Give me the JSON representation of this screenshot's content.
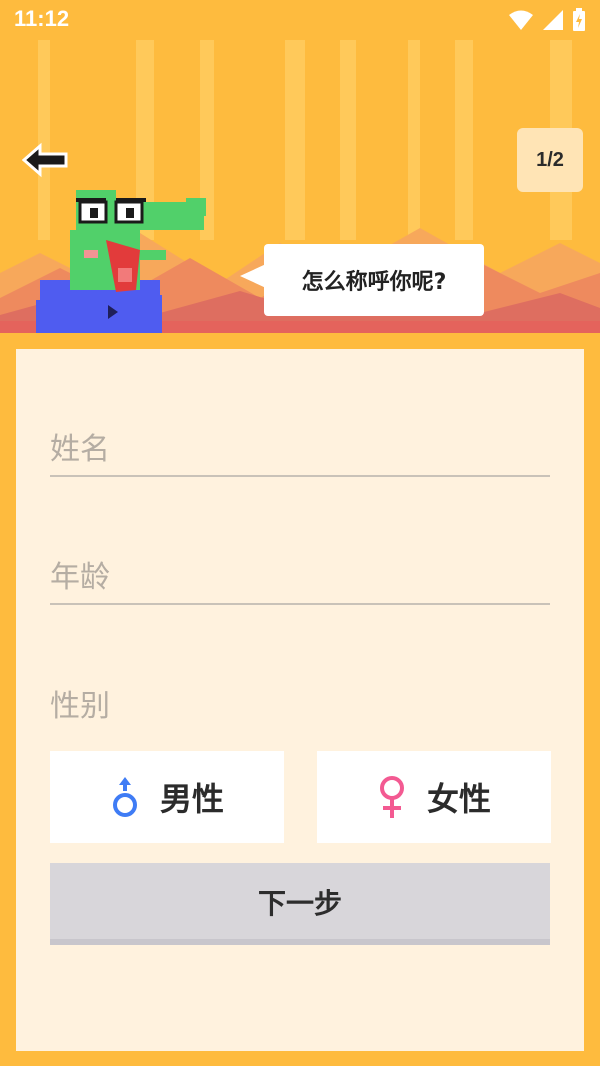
{
  "status_bar": {
    "time": "11:12",
    "icons": [
      "wifi-icon",
      "cell-signal-icon",
      "battery-charging-icon"
    ]
  },
  "header": {
    "page_indicator": "1/2",
    "speech_bubble": "怎么称呼你呢?",
    "back_icon": "back-arrow-icon"
  },
  "form": {
    "name": {
      "value": "",
      "placeholder": "姓名"
    },
    "age": {
      "value": "",
      "placeholder": "年龄"
    },
    "gender": {
      "label": "性别",
      "options": [
        {
          "label": "男性",
          "icon": "male-icon",
          "icon_color": "#3F7CF5"
        },
        {
          "label": "女性",
          "icon": "female-icon",
          "icon_color": "#F35A92"
        }
      ]
    },
    "next_button_label": "下一步"
  },
  "colors": {
    "background": "#FEBB3E",
    "card": "#FFF2DE",
    "button_disabled": "#D8D6DA"
  }
}
